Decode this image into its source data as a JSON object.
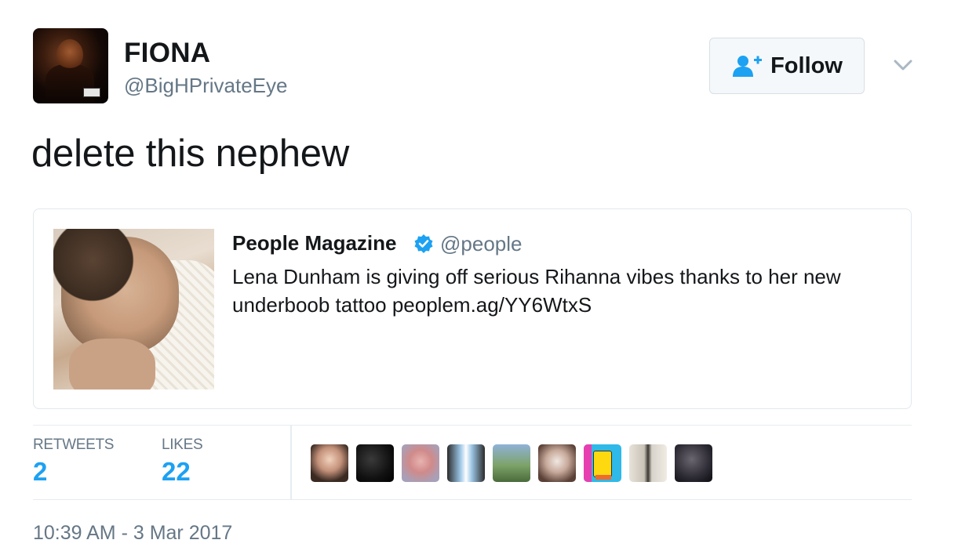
{
  "author": {
    "name": "FIONA",
    "handle": "@BigHPrivateEye",
    "avatar_icon": "profile-photo"
  },
  "follow_button": {
    "label": "Follow",
    "icon": "add-user-icon",
    "accent": "#1da1f2"
  },
  "tweet": {
    "text": "delete this nephew",
    "timestamp": "10:39 AM - 3 Mar 2017"
  },
  "quoted_tweet": {
    "name": "People Magazine",
    "verified": true,
    "handle": "@people",
    "text": "Lena Dunham is giving off serious Rihanna vibes thanks to her new underboob tattoo peoplem.ag/YY6WtxS"
  },
  "stats": {
    "retweets_label": "RETWEETS",
    "retweets_value": "2",
    "likes_label": "LIKES",
    "likes_value": "22"
  },
  "likers_count": 9,
  "colors": {
    "link": "#1da1f2",
    "secondary_text": "#657786",
    "border": "#e1e8ed"
  }
}
